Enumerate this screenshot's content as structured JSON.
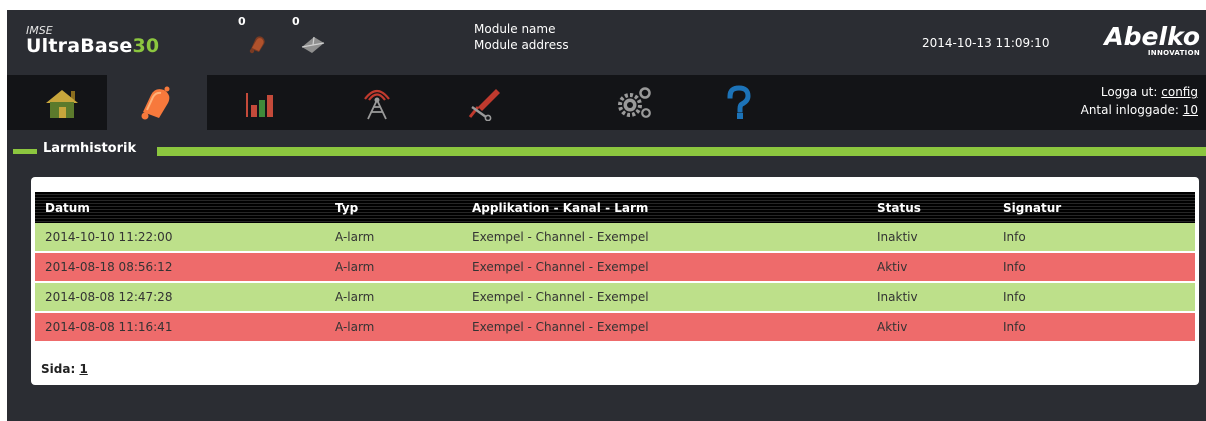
{
  "header": {
    "brand_prefix": "IMSE",
    "brand_name": "UltraBase",
    "brand_number": "30",
    "alarm_count": "0",
    "message_count": "0",
    "module_name_label": "Module name",
    "module_address_label": "Module address",
    "datetime": "2014-10-13 11:09:10",
    "logo_text": "Abelko",
    "logo_sub": "INNOVATION"
  },
  "nav": {
    "items": [
      {
        "name": "home-icon",
        "color": "#c8a63c"
      },
      {
        "name": "alarm-bell-icon",
        "color": "#f7793c"
      },
      {
        "name": "bar-chart-icon",
        "color": "#c44a3a"
      },
      {
        "name": "antenna-icon",
        "color": "#9a9a9a"
      },
      {
        "name": "tools-icon",
        "color": "#c03a2e"
      },
      {
        "name": "gears-icon",
        "color": "#9a9a9a"
      },
      {
        "name": "help-icon",
        "color": "#1c73b8"
      }
    ],
    "active_index": 1,
    "logout_label": "Logga ut:",
    "logout_user": "config",
    "logged_in_label": "Antal inloggade:",
    "logged_in_count": "10"
  },
  "section": {
    "title": "Larmhistorik"
  },
  "table": {
    "columns": [
      "Datum",
      "Typ",
      "Applikation - Kanal - Larm",
      "Status",
      "Signatur"
    ],
    "rows": [
      {
        "date": "2014-10-10 11:22:00",
        "type": "A-larm",
        "app": "Exempel - Channel - Exempel",
        "status": "Inaktiv",
        "signature": "Info",
        "state": "inactive"
      },
      {
        "date": "2014-08-18 08:56:12",
        "type": "A-larm",
        "app": "Exempel - Channel - Exempel",
        "status": "Aktiv",
        "signature": "Info",
        "state": "active"
      },
      {
        "date": "2014-08-08 12:47:28",
        "type": "A-larm",
        "app": "Exempel - Channel - Exempel",
        "status": "Inaktiv",
        "signature": "Info",
        "state": "inactive"
      },
      {
        "date": "2014-08-08 11:16:41",
        "type": "A-larm",
        "app": "Exempel - Channel - Exempel",
        "status": "Aktiv",
        "signature": "Info",
        "state": "active"
      }
    ]
  },
  "pagination": {
    "label": "Sida:",
    "page": "1"
  },
  "colors": {
    "background": "#2b2d33",
    "nav_background": "#131417",
    "accent_green": "#8cc63f",
    "row_inactive": "#bde08a",
    "row_active": "#ee6b6b"
  }
}
